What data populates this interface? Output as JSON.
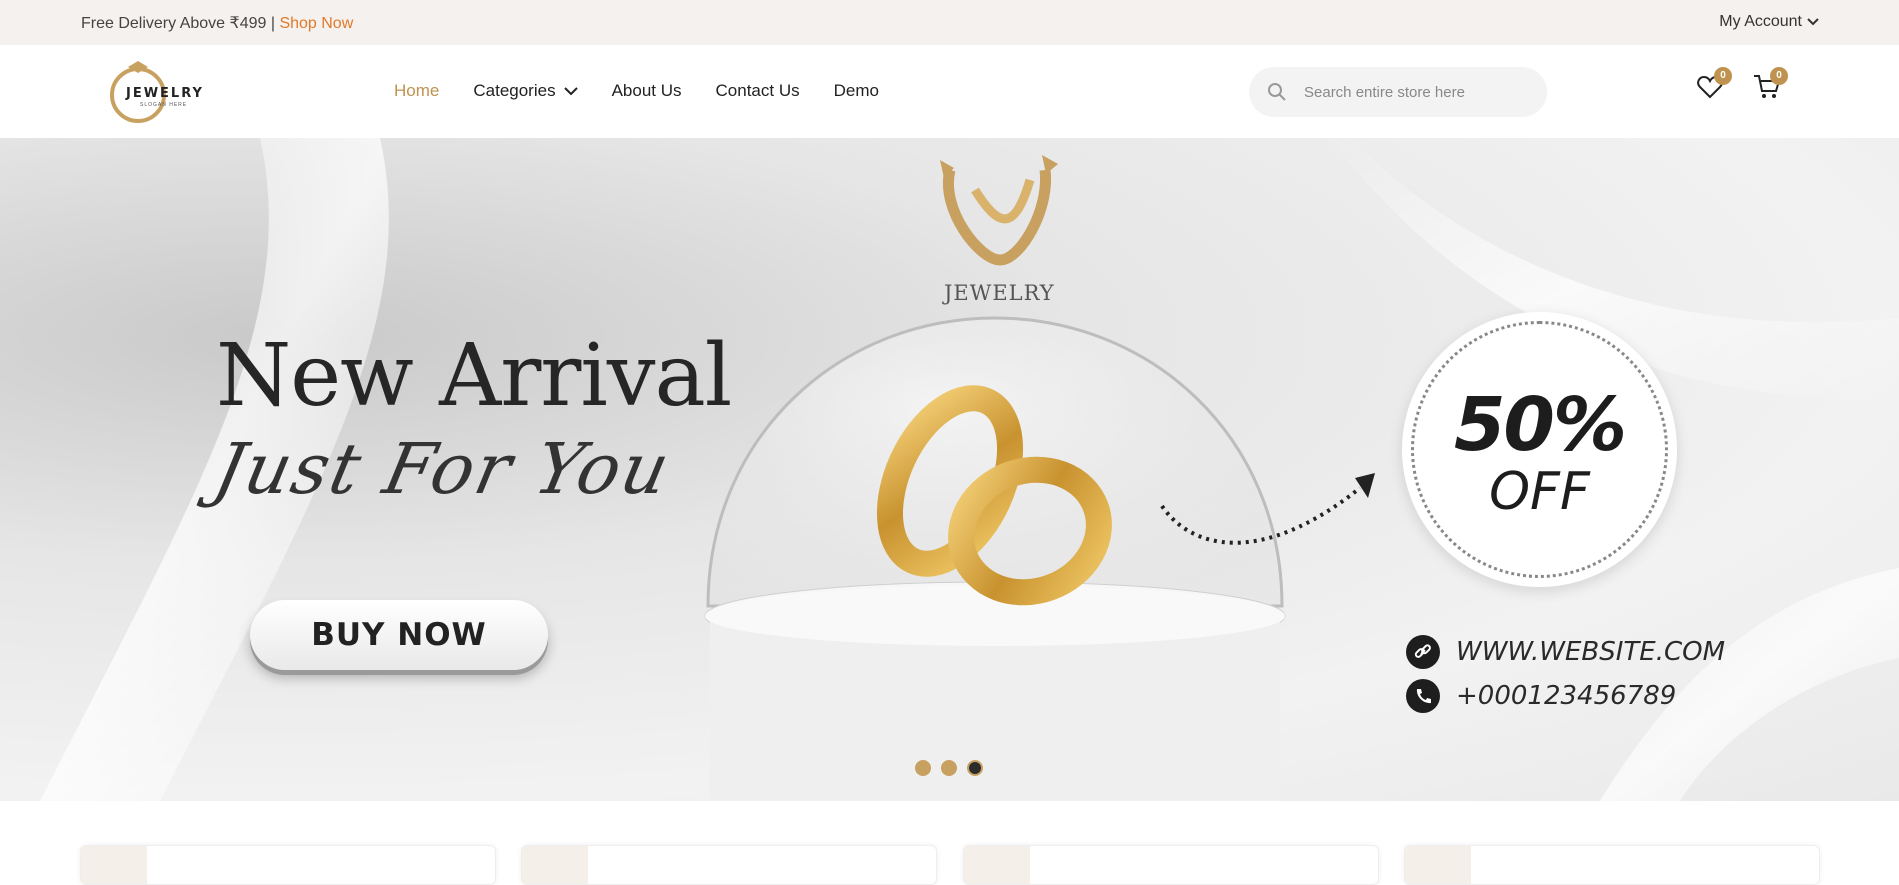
{
  "topbar": {
    "promo_text": "Free Delivery Above ₹499 |",
    "promo_link": "Shop Now",
    "account_label": "My Account"
  },
  "header": {
    "logo": {
      "name": "JEWELRY",
      "slogan": "SLOGAN HERE"
    },
    "nav": [
      {
        "label": "Home",
        "active": true
      },
      {
        "label": "Categories",
        "has_dropdown": true
      },
      {
        "label": "About Us"
      },
      {
        "label": "Contact Us"
      },
      {
        "label": "Demo"
      }
    ],
    "search": {
      "placeholder": "Search entire store here",
      "value": ""
    },
    "wishlist_count": "0",
    "cart_count": "0"
  },
  "hero": {
    "headline": "New Arrival",
    "script": "Just For You",
    "cta": "BUY NOW",
    "brand": "JEWELRY",
    "offer_value": "50%",
    "offer_label": "OFF",
    "website": "WWW.WEBSITE.COM",
    "phone": "+000123456789",
    "slides": {
      "count": 3,
      "active_index": 2
    }
  },
  "colors": {
    "accent": "#c0924f",
    "promo_link": "#e07a2a",
    "topbar_bg": "#f5f1ee",
    "dot_gold": "#c8a060"
  },
  "icons": {
    "search": "search-icon",
    "wishlist": "heart-icon",
    "cart": "cart-icon",
    "dropdown": "chevron-down-icon",
    "link": "link-icon",
    "phone": "phone-icon"
  }
}
